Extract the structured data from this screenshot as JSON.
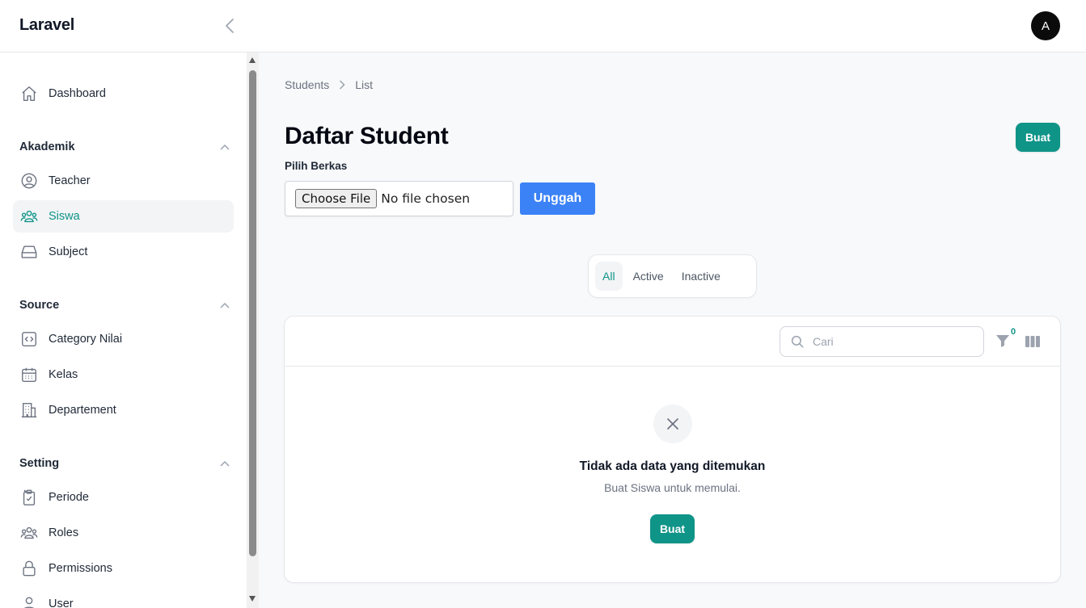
{
  "header": {
    "brand": "Laravel",
    "avatar_initial": "A"
  },
  "sidebar": {
    "dashboard": "Dashboard",
    "groups": [
      {
        "label": "Akademik",
        "items": [
          "Teacher",
          "Siswa",
          "Subject"
        ]
      },
      {
        "label": "Source",
        "items": [
          "Category Nilai",
          "Kelas",
          "Departement"
        ]
      },
      {
        "label": "Setting",
        "items": [
          "Periode",
          "Roles",
          "Permissions",
          "User"
        ]
      }
    ],
    "active_item": "Siswa"
  },
  "breadcrumb": {
    "parent": "Students",
    "current": "List"
  },
  "page": {
    "title": "Daftar Student",
    "create_label": "Buat"
  },
  "upload": {
    "label": "Pilih Berkas",
    "choose_button": "Choose File",
    "no_file_text": "No file chosen",
    "submit_label": "Unggah"
  },
  "tabs": {
    "all": "All",
    "active": "Active",
    "inactive": "Inactive",
    "selected": "All"
  },
  "table": {
    "search_placeholder": "Cari",
    "filter_count": "0",
    "empty_title": "Tidak ada data yang ditemukan",
    "empty_description": "Buat Siswa untuk memulai.",
    "empty_create_label": "Buat"
  },
  "colors": {
    "primary": "#0f9488",
    "upload": "#3b82f6",
    "active_bg": "#f3f4f6"
  }
}
